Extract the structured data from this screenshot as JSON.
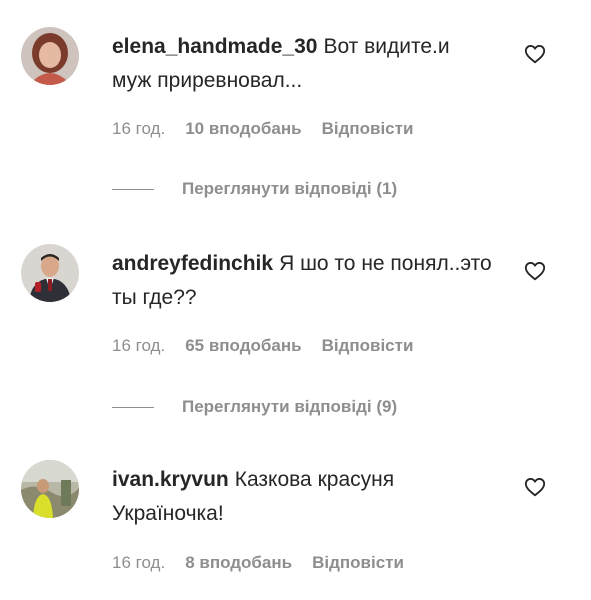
{
  "comments": [
    {
      "username": "elena_handmade_30",
      "text": "Вот видите.и муж приревновал...",
      "time": "16 год.",
      "likes": "10 вподобань",
      "reply": "Відповісти",
      "view_replies": "Переглянути відповіді (1)",
      "avatar": "woman-avatar"
    },
    {
      "username": "andreyfedinchik",
      "text": "Я шо то не понял..это ты где??",
      "time": "16 год.",
      "likes": "65 вподобань",
      "reply": "Відповісти",
      "view_replies": "Переглянути відповіді (9)",
      "avatar": "man-in-suit-avatar"
    },
    {
      "username": "ivan.kryvun",
      "text": "Казкова красуня Україночка!",
      "time": "16 год.",
      "likes": "8 вподобань",
      "reply": "Відповісти",
      "avatar": "man-outdoors-avatar"
    }
  ],
  "colors": {
    "text": "#262626",
    "secondary": "#8e8e8e",
    "background": "#ffffff"
  },
  "icons": {
    "like": "heart-outline-icon"
  }
}
